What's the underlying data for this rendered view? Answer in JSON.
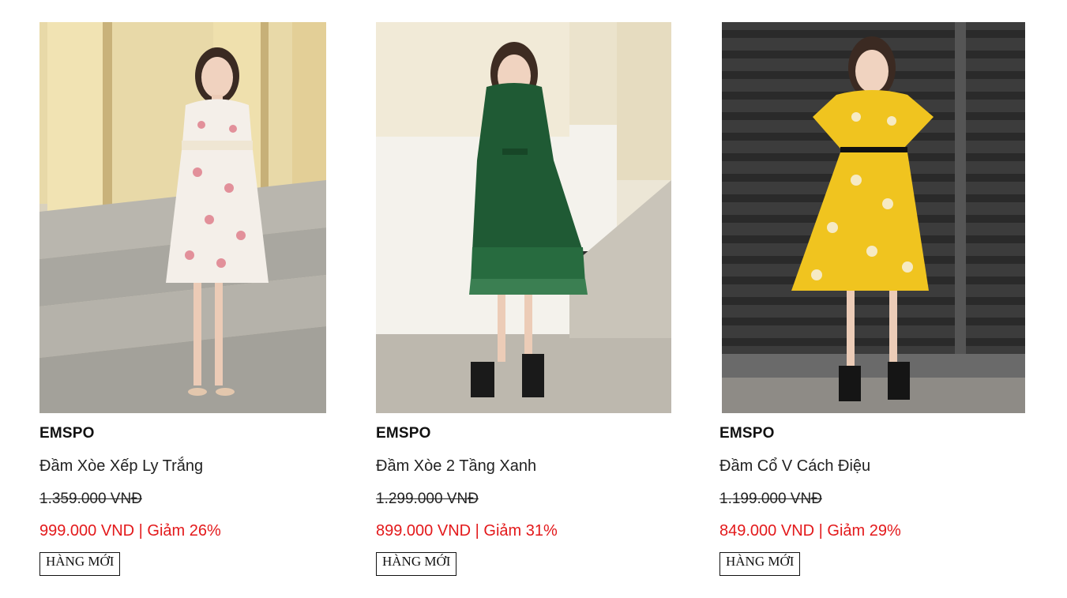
{
  "products": [
    {
      "brand": "EMSPO",
      "name": "Đầm Xòe Xếp Ly Trắng",
      "old_price": "1.359.000 VNĐ",
      "sale_price": "999.000 VND",
      "separator": " | ",
      "discount": "Giảm 26%",
      "badge": "HÀNG MỚI"
    },
    {
      "brand": "EMSPO",
      "name": "Đầm Xòe 2 Tầng Xanh",
      "old_price": "1.299.000 VNĐ",
      "sale_price": "899.000 VND",
      "separator": " | ",
      "discount": "Giảm 31%",
      "badge": "HÀNG MỚI"
    },
    {
      "brand": "EMSPO",
      "name": "Đầm Cổ V Cách Điệu",
      "old_price": "1.199.000 VNĐ",
      "sale_price": "849.000 VND",
      "separator": " | ",
      "discount": "Giảm 29%",
      "badge": "HÀNG MỚI"
    }
  ],
  "colors": {
    "sale_red": "#e3191b",
    "text": "#111111"
  }
}
